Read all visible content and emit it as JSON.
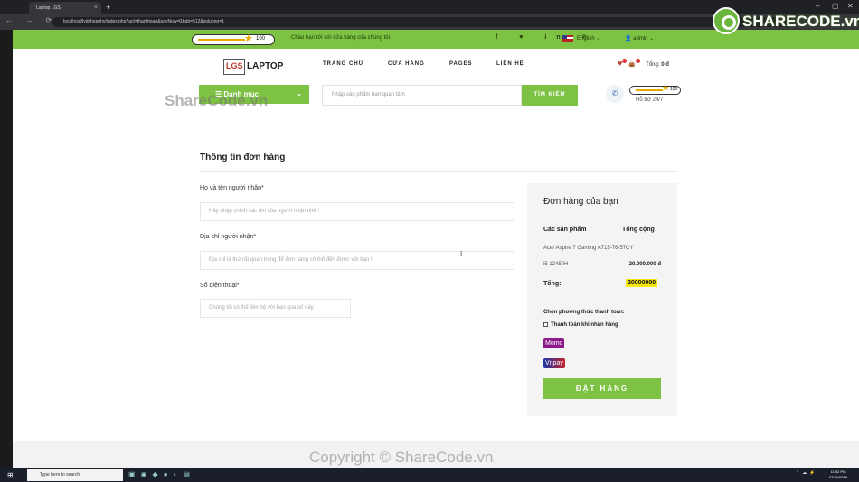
{
  "browser": {
    "tab_title": "Laptop LGS",
    "tab_close": "×",
    "new_tab": "+",
    "url": "localhost/lydshopphy/index.php?act=thanhtoan&payNow=0&gb=512&soluong=1",
    "nav_buttons": "← → ⟳",
    "window_controls": [
      "–",
      "▢",
      "✕"
    ]
  },
  "topbar": {
    "coin_left": "100",
    "message": "Chào bạn tới với cửa hàng của chúng tôi !",
    "social": "f ♥ in ℗",
    "language": "English",
    "user": "admin"
  },
  "header": {
    "logo_box": "LGS",
    "logo_text": "LAPTOP",
    "menu": [
      "TRANG CHỦ",
      "CỬA HÀNG",
      "PAGES",
      "LIÊN HỆ"
    ],
    "wishlist_count": "0",
    "cart_count": "0",
    "total_label": "Tổng:",
    "total_value": "0 đ"
  },
  "category": {
    "label": "Danh mục"
  },
  "search": {
    "placeholder": "Nhập sản phẩm bạn quan tâm",
    "button": "TÌM KIẾM"
  },
  "support": {
    "coin": "100",
    "label": "Hỗ trợ 24/7"
  },
  "watermarks": {
    "top": "ShareCode.vn",
    "bottom": "Copyright © ShareCode.vn",
    "logo": "SHARECODE.vn"
  },
  "form": {
    "title": "Thông tin đơn hàng",
    "name_label": "Họ và tên người nhận*",
    "name_placeholder": "Hãy nhập chính xác tên của người nhận nhé !",
    "address_label": "Địa chỉ người nhận*",
    "address_placeholder": "Địa chỉ là thứ rất quan trọng để đơn hàng có thể đến được với bạn !",
    "phone_label": "Số điện thoại*",
    "phone_placeholder": "Chúng tôi có thể liên hệ với bạn qua số này"
  },
  "order": {
    "title": "Đơn hàng của bạn",
    "col_product": "Các sản phẩm",
    "col_total": "Tổng cộng",
    "product_name": "Acer Aspire 7 Gaming A715-76-57CY",
    "product_variant": "i5 12450H",
    "product_price": "20.000.000 đ",
    "total_label": "Tổng:",
    "total_value": "20000000",
    "payment_label": "Chọn phương thức thanh toán:",
    "cod_label": "Thanh toán khi nhận hàng",
    "momo": "Momo",
    "vnpay": "Vnpay",
    "submit": "ĐẶT HÀNG"
  },
  "taskbar": {
    "search_placeholder": "Type here to search",
    "time": "11:52 PM",
    "date": "07/01/2023"
  },
  "colors": {
    "accent": "#7dc242",
    "highlight": "#f5e90c"
  }
}
